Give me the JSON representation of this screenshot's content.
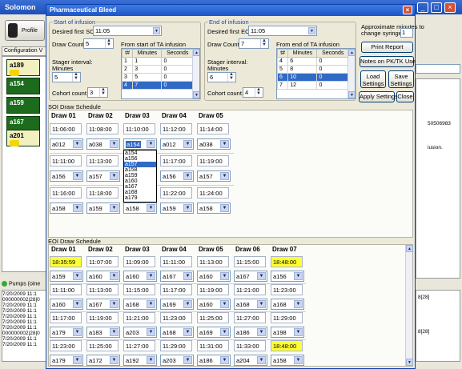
{
  "background": {
    "app_title": "Solomon",
    "profile_label": "Profile",
    "config_tab": "Configuration V",
    "beds": [
      "a189",
      "a154",
      "a159",
      "a167",
      "a201"
    ],
    "pumps_label": "Pumps (oine",
    "log_lines": [
      "7/20/2009 11:1",
      "000000002|28|0",
      "7/20/2009 11:1",
      "7/20/2009 11:1",
      "7/20/2009 11:1",
      "7/20/2009 11:1",
      "7/20/2009 11:1",
      "000000002|28|0",
      "7/20/2009 11:1",
      "7/20/2009 11:1"
    ],
    "right_texts": [
      "50506983",
      "iusion.",
      "8[28]",
      "8[28]"
    ]
  },
  "dialog": {
    "title": "Pharmaceutical Bleed",
    "start": {
      "group_title": "Start of infusion",
      "desired_label": "Desired first SOI:",
      "desired_value": "11:05",
      "draw_count_label": "Draw Count",
      "draw_count_value": "5",
      "from_label": "From start of TA infusion",
      "table_headers": [
        "t#",
        "Minutes",
        "Seconds"
      ],
      "table_rows": [
        [
          "1",
          "1",
          "0"
        ],
        [
          "2",
          "3",
          "0"
        ],
        [
          "3",
          "5",
          "0"
        ],
        [
          "4",
          "7",
          "0"
        ]
      ],
      "stagger_label": "Stager interval:",
      "minutes_label": "Minutes",
      "stagger_value": "5",
      "cohort_label": "Cohort count:",
      "cohort_value": "3"
    },
    "end": {
      "group_title": "End of infusion",
      "desired_label": "Desired first EOI:",
      "desired_value": "11:05",
      "draw_count_label": "Draw Count",
      "draw_count_value": "7",
      "from_label": "From end of TA infusion",
      "table_headers": [
        "t#",
        "Minutes",
        "Seconds"
      ],
      "table_rows": [
        [
          "4",
          "6",
          "0"
        ],
        [
          "5",
          "8",
          "0"
        ],
        [
          "6",
          "10",
          "0"
        ],
        [
          "7",
          "12",
          "0"
        ]
      ],
      "stagger_label": "Stager interval:",
      "minutes_label": "Minutes",
      "stagger_value": "6",
      "cohort_label": "Cohort count:",
      "cohort_value": "4"
    },
    "approx_label_1": "Approximate minutes to",
    "approx_label_2": "change syringe:",
    "approx_value": "1",
    "buttons": {
      "print": "Print Report",
      "notes": "Notes on PK/TK Use",
      "load": [
        "Load",
        "Settings"
      ],
      "save": [
        "Save",
        "Settings"
      ],
      "apply": "Apply Settings",
      "close": "Close"
    },
    "soi": {
      "title": "SOI Draw Schedule",
      "headers": [
        "Draw 01",
        "Draw 02",
        "Draw 03",
        "Draw 04",
        "Draw 05"
      ],
      "rows": [
        {
          "times": [
            "11:06:00",
            "11:08:00",
            "11:10:00",
            "11:12:00",
            "11:14:00"
          ],
          "ids": [
            "a012",
            "a038",
            "a154",
            "a012",
            "a038"
          ]
        },
        {
          "times": [
            "11:11:00",
            "11:13:00",
            "",
            "11:17:00",
            "11:19:00"
          ],
          "ids": [
            "a156",
            "a157",
            "",
            "a156",
            "a157"
          ]
        },
        {
          "times": [
            "11:16:00",
            "11:18:00",
            "",
            "11:22:00",
            "11:24:00"
          ],
          "ids": [
            "a158",
            "a159",
            "a158",
            "a159",
            "a158"
          ]
        }
      ],
      "dropdown_options": [
        "a154",
        "a156",
        "a157",
        "a158",
        "a159",
        "a160",
        "a167",
        "a168",
        "a179"
      ]
    },
    "eoi": {
      "title": "EOI Draw Schedule",
      "headers": [
        "Draw 01",
        "Draw 02",
        "Draw 03",
        "Draw 04",
        "Draw 05",
        "Draw 06",
        "Draw 07"
      ],
      "rows": [
        {
          "times": [
            "18:35:59",
            "11:07:00",
            "11:09:00",
            "11:11:00",
            "11:13:00",
            "11:15:00",
            "18:48:00"
          ],
          "ids": [
            "a159",
            "a160",
            "a160",
            "a167",
            "a160",
            "a167",
            "a156"
          ]
        },
        {
          "times": [
            "11:11:00",
            "11:13:00",
            "11:15:00",
            "11:17:00",
            "11:19:00",
            "11:21:00",
            "11:23:00"
          ],
          "ids": [
            "a160",
            "a167",
            "a168",
            "a169",
            "a160",
            "a168",
            "a168"
          ]
        },
        {
          "times": [
            "11:17:00",
            "11:19:00",
            "11:21:00",
            "11:23:00",
            "11:25:00",
            "11:27:00",
            "11:29:00"
          ],
          "ids": [
            "a179",
            "a183",
            "a203",
            "a168",
            "a169",
            "a186",
            "a198"
          ]
        },
        {
          "times": [
            "11:23:00",
            "11:25:00",
            "11:27:00",
            "11:29:00",
            "11:31:00",
            "11:33:00",
            "18:48:00"
          ],
          "ids": [
            "a179",
            "a172",
            "a192",
            "a203",
            "a186",
            "a204",
            "a158"
          ]
        }
      ],
      "highlight_color": "#ffff33"
    }
  }
}
